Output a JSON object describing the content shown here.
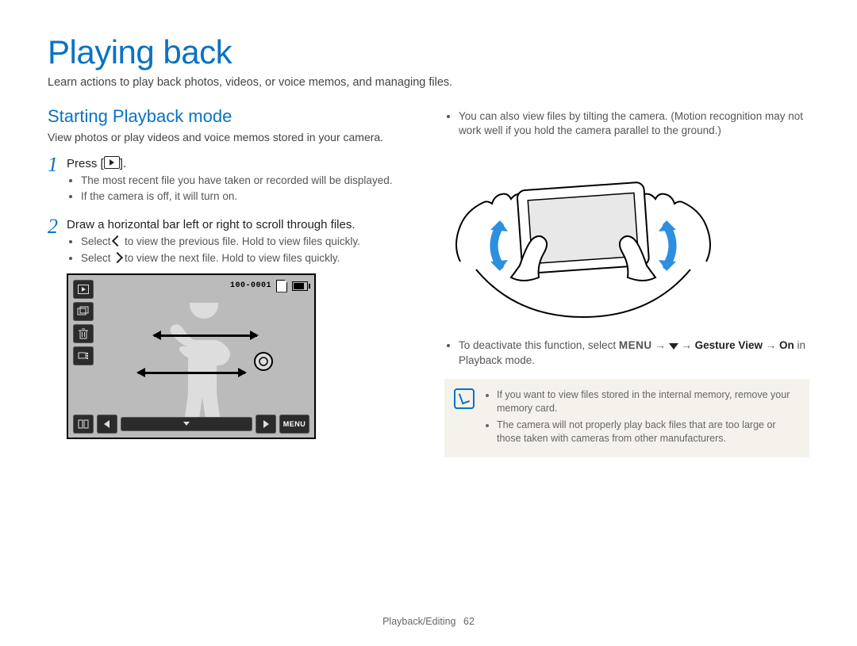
{
  "title": "Playing back",
  "subtitle": "Learn actions to play back photos, videos, or voice memos, and managing files.",
  "left": {
    "heading": "Starting Playback mode",
    "desc": "View photos or play videos and voice memos stored in your camera.",
    "step1": {
      "num": "1",
      "text_before": "Press [",
      "text_after": "].",
      "bullets": [
        "The most recent file you have taken or recorded will be displayed.",
        "If the camera is off, it will turn on."
      ]
    },
    "step2": {
      "num": "2",
      "text": "Draw a horizontal bar left or right to scroll through files.",
      "bullet_prev_a": "Select ",
      "bullet_prev_b": " to view the previous file. Hold to view files quickly.",
      "bullet_next_a": "Select ",
      "bullet_next_b": " to view the next file. Hold to view files quickly."
    },
    "screen": {
      "file_counter": "100-0001",
      "menu_label": "MENU"
    }
  },
  "right": {
    "tilt_bullet": "You can also view files by tilting the camera. (Motion recognition may not work well if you hold the camera parallel to the ground.)",
    "deactivate_a": "To deactivate this function, select ",
    "menu_word": "MENU",
    "arrow": " → ",
    "deactivate_b": " → ",
    "gesture_view": "Gesture View",
    "arrow2": " → ",
    "on_word": "On",
    "deactivate_c": " in Playback mode.",
    "notes": [
      "If you want to view files stored in the internal memory, remove your memory card.",
      "The camera will not properly play back files that are too large or those taken with cameras from other manufacturers."
    ]
  },
  "footer": {
    "section": "Playback/Editing",
    "page": "62"
  }
}
